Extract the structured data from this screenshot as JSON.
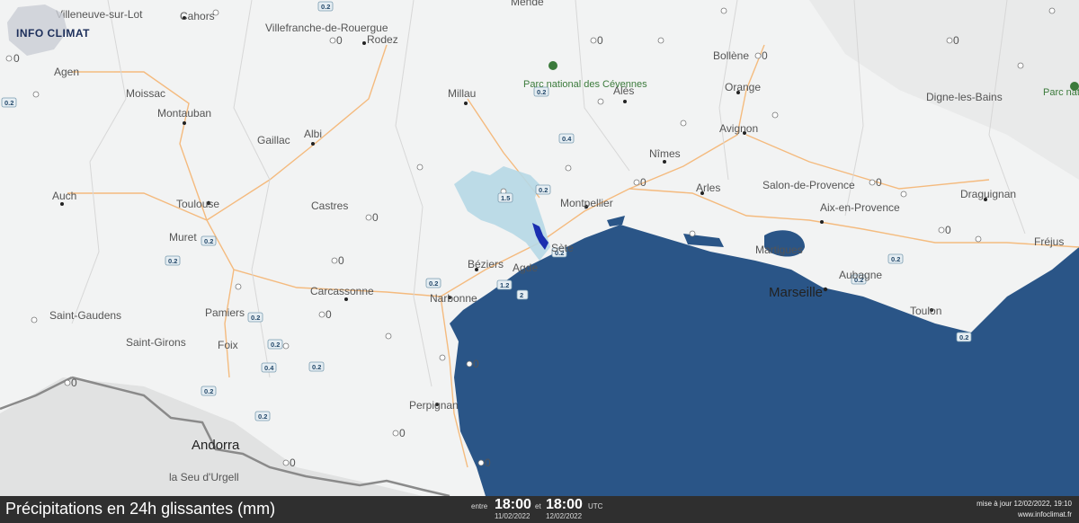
{
  "logo": {
    "text": "INFO CLIMAT"
  },
  "footer": {
    "title": "Précipitations en 24h glissantes (mm)",
    "entre_label": "entre",
    "start_time": "18:00",
    "start_date": "11/02/2022",
    "et_label": "et",
    "end_time": "18:00",
    "end_date": "12/02/2022",
    "utc_label": "UTC",
    "update_line": "mise à jour 12/02/2022, 19:10",
    "site": "www.infoclimat.fr"
  },
  "places": {
    "andorra": "Andorra",
    "marseille": "Marseille",
    "toulouse": "Toulouse",
    "montpellier": "Montpellier",
    "nimes": "Nîmes",
    "avignon": "Avignon",
    "arles": "Arles",
    "beziers": "Béziers",
    "narbonne": "Narbonne",
    "carcassonne": "Carcassonne",
    "perpignan": "Perpignan",
    "toulon": "Toulon",
    "aix": "Aix-en-Provence",
    "draguignan": "Draguignan",
    "digne": "Digne-les-Bains",
    "rodez": "Rodez",
    "albi": "Albi",
    "montauban": "Montauban",
    "auch": "Auch",
    "millau": "Millau",
    "ales": "Alès",
    "orange": "Orange",
    "bollene": "Bollène",
    "cahors": "Cahors",
    "agen": "Agen",
    "moissac": "Moissac",
    "gaillac": "Gaillac",
    "castres": "Castres",
    "muret": "Muret",
    "pamiers": "Pamiers",
    "foix": "Foix",
    "saint_girons": "Saint-Girons",
    "saint_gaudens": "Saint-Gaudens",
    "la_seu": "la Seu d'Urgell",
    "agde": "Agde",
    "sete": "Sète",
    "salon": "Salon-de-Provence",
    "aubagne": "Aubagne",
    "martigues": "Martigues",
    "frejus": "Fréjus",
    "villeneuve": "Villeneuve-sur-Lot",
    "villefranche": "Villefranche-de-Rouergue",
    "mende": "Mende",
    "parc_cevennes": "Parc national des Cévennes",
    "parc_mercantour": "Parc national du Mercantour"
  },
  "badges": [
    "0.2",
    "0.2",
    "0.2",
    "0.4",
    "1.5",
    "0.2",
    "0.2",
    "0.2",
    "0.2",
    "1.2",
    "2",
    "0.2",
    "0.2",
    "0.2",
    "0.4",
    "0.2",
    "0.2",
    "0.2",
    "0.2",
    "0.2",
    "0.2"
  ],
  "zero_label": "0",
  "colors": {
    "sea": "#2a5587",
    "land": "#f2f3f3",
    "rain_light": "#b6d8e6",
    "rain_dark": "#1a2fb0",
    "road": "#f5b16a",
    "border": "#8a8a8a"
  }
}
